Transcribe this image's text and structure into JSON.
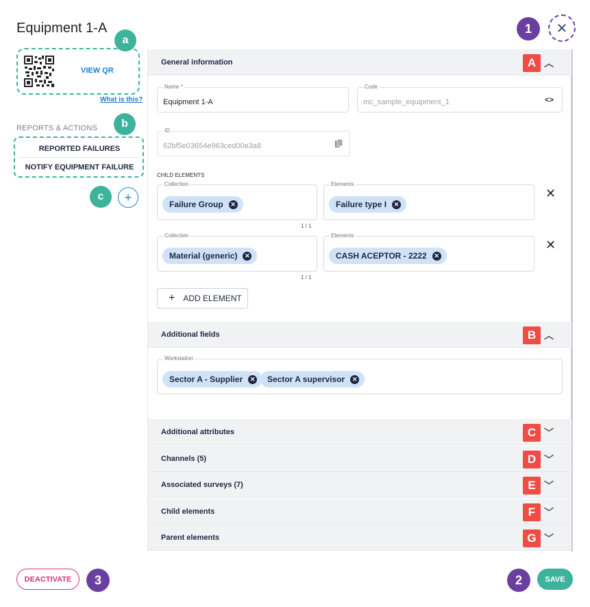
{
  "page": {
    "title": "Equipment 1-A"
  },
  "annotations": {
    "close": "1",
    "save": "2",
    "deactivate": "3",
    "qr": "a",
    "reports": "b",
    "add": "c",
    "sections": [
      "A",
      "B",
      "C",
      "D",
      "E",
      "F",
      "G"
    ]
  },
  "left": {
    "view_qr": "VIEW QR",
    "what_is_this": "What is this?",
    "reports_label": "REPORTS & ACTIONS",
    "actions": [
      "REPORTED FAILURES",
      "NOTIFY EQUIPMENT FAILURE"
    ],
    "add_icon": "plus-icon"
  },
  "general": {
    "header": "General information",
    "name": {
      "label": "Name *",
      "value": "Equipment 1-A"
    },
    "code": {
      "label": "Code",
      "value": "mc_sample_equipment_1"
    },
    "id": {
      "label": "ID",
      "value": "62bf5e03654e963ced00e3a8"
    },
    "child_label": "CHILD ELEMENTS",
    "rows": [
      {
        "collection_label": "Collection",
        "collection": "Failure Group",
        "elements_label": "Elements",
        "element": "Failure type I",
        "count": "1 / 1"
      },
      {
        "collection_label": "Collection",
        "collection": "Material (generic)",
        "elements_label": "Elements",
        "element": "CASH ACEPTOR - 2222",
        "count": "1 / 1"
      }
    ],
    "add_element": "ADD ELEMENT"
  },
  "additional_fields": {
    "header": "Additional fields",
    "workstation_label": "Workstation",
    "chips": [
      "Sector A - Supplier",
      "Sector A supervisor"
    ]
  },
  "collapsed_sections": [
    "Additional attributes",
    "Channels (5)",
    "Associated surveys (7)",
    "Child elements",
    "Parent elements"
  ],
  "footer": {
    "deactivate": "DEACTIVATE",
    "save": "SAVE"
  },
  "colors": {
    "accent_green": "#3cb39a",
    "purple": "#6b3fa0",
    "marker_red": "#ef4c46",
    "link_blue": "#1b7fd1",
    "danger": "#d8317a"
  }
}
